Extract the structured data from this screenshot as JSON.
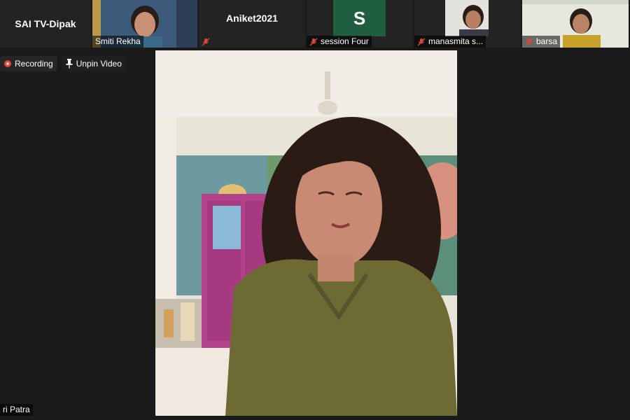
{
  "participants": [
    {
      "name": "SAI TV-Dipak",
      "video": false
    },
    {
      "name": "Smiti Rekha",
      "video": true
    },
    {
      "name": "Aniket2021",
      "video": false
    },
    {
      "name": "session Four",
      "video": false,
      "avatar_letter": "S",
      "muted": true
    },
    {
      "name": "manasmita s...",
      "video": true,
      "muted": true
    },
    {
      "name": "barsa",
      "video": true,
      "muted": true
    }
  ],
  "controls": {
    "recording_label": "Recording",
    "unpin_label": "Unpin Video"
  },
  "pinned_speaker": {
    "label": "ri Patra"
  },
  "colors": {
    "background": "#1a1a1a",
    "recording": "#e0463c",
    "avatar": "#1f5e3e",
    "muted": "#e0463c"
  }
}
